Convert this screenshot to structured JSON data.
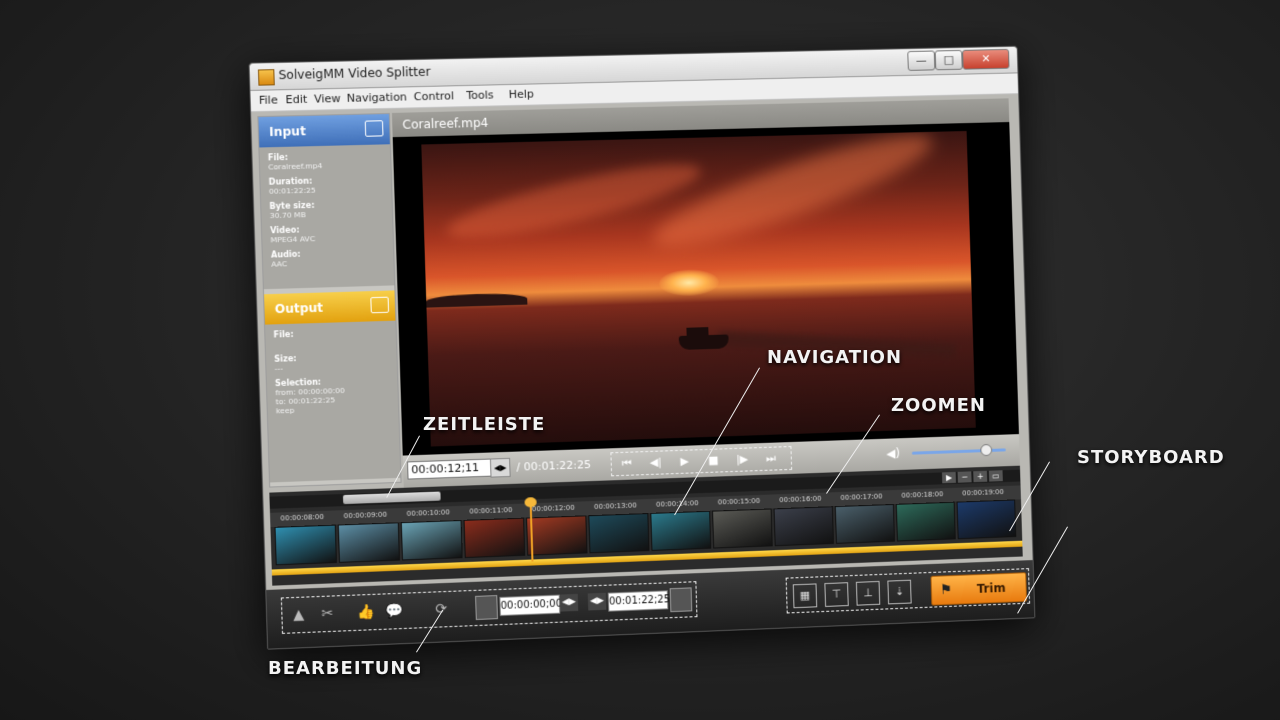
{
  "window": {
    "title": "SolveigMM Video Splitter",
    "min": "—",
    "max": "□",
    "close": "✕"
  },
  "menu": [
    "File",
    "Edit",
    "View",
    "Navigation",
    "Control",
    "Tools",
    "Help"
  ],
  "input_panel": {
    "header": "Input",
    "fields": [
      {
        "label": "File:",
        "value": "Coralreef.mp4"
      },
      {
        "label": "Duration:",
        "value": "00:01:22:25"
      },
      {
        "label": "Byte size:",
        "value": "30.70 MB"
      },
      {
        "label": "Video:",
        "value": "MPEG4 AVC"
      },
      {
        "label": "Audio:",
        "value": "AAC"
      }
    ]
  },
  "output_panel": {
    "header": "Output",
    "fields": [
      {
        "label": "File:",
        "value": ""
      },
      {
        "label": "Size:",
        "value": "---"
      },
      {
        "label": "Selection:",
        "value": "from: 00:00:00:00\nto: 00:01:22:25\nkeep"
      }
    ]
  },
  "video": {
    "file_name": "Coralreef.mp4"
  },
  "controls": {
    "current_time": "00:00:12;11",
    "total_time": "/ 00:01:22:25",
    "nav_buttons": [
      "⏮",
      "◀|",
      "▶",
      "■",
      "|▶",
      "⏭"
    ]
  },
  "timeline": {
    "ticks": [
      "00:00:08:00",
      "00:00:09:00",
      "00:00:10:00",
      "00:00:11:00",
      "00:00:12:00",
      "00:00:13:00",
      "00:00:14:00",
      "00:00:15:00",
      "00:00:16:00",
      "00:00:17:00",
      "00:00:18:00",
      "00:00:19:00"
    ],
    "frame_colors": [
      "#2f8fb0",
      "#5c8ea5",
      "#6aa3b5",
      "#8a2c1c",
      "#a33a22",
      "#1e4a5a",
      "#2b7a8c",
      "#5a5a55",
      "#3b3f4a",
      "#4a5f6a",
      "#2d6a5a",
      "#1c3a6a"
    ],
    "playhead_fraction": 0.34
  },
  "bottom": {
    "start_time": "00:00:00;00",
    "end_time": "00:01:22;25",
    "trim_label": "Trim"
  },
  "callouts": {
    "navigation": "NAVIGATION",
    "zoomen": "ZOOMEN",
    "zeitleiste": "ZEITLEISTE",
    "storyboard": "STORYBOARD",
    "bearbeitung": "BEARBEITUNG"
  },
  "colors": {
    "input_header": "#4f7fc8",
    "output_header": "#eeb52a",
    "trim": "#f39a2a",
    "timeline_accent": "#f2b51f"
  }
}
